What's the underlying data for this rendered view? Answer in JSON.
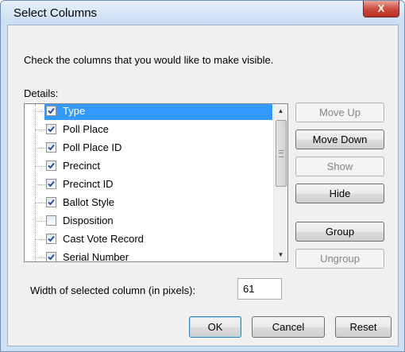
{
  "window": {
    "title": "Select Columns",
    "close_label": "X"
  },
  "instruction": "Check the columns that you would like to make visible.",
  "details_label": "Details:",
  "columns": [
    {
      "label": "Type",
      "checked": true,
      "selected": true
    },
    {
      "label": "Poll Place",
      "checked": true,
      "selected": false
    },
    {
      "label": "Poll Place ID",
      "checked": true,
      "selected": false
    },
    {
      "label": "Precinct",
      "checked": true,
      "selected": false
    },
    {
      "label": "Precinct ID",
      "checked": true,
      "selected": false
    },
    {
      "label": "Ballot Style",
      "checked": true,
      "selected": false
    },
    {
      "label": "Disposition",
      "checked": false,
      "selected": false
    },
    {
      "label": "Cast Vote Record",
      "checked": true,
      "selected": false
    },
    {
      "label": "Serial Number",
      "checked": true,
      "selected": false
    }
  ],
  "side_buttons": {
    "move_up": "Move Up",
    "move_down": "Move Down",
    "show": "Show",
    "hide": "Hide",
    "group": "Group",
    "ungroup": "Ungroup"
  },
  "width_field": {
    "label": "Width of selected column (in pixels):",
    "value": "61"
  },
  "footer": {
    "ok": "OK",
    "cancel": "Cancel",
    "reset": "Reset"
  },
  "colors": {
    "selection": "#3399ff",
    "check": "#2a4fa3",
    "close": "#c9473a"
  }
}
